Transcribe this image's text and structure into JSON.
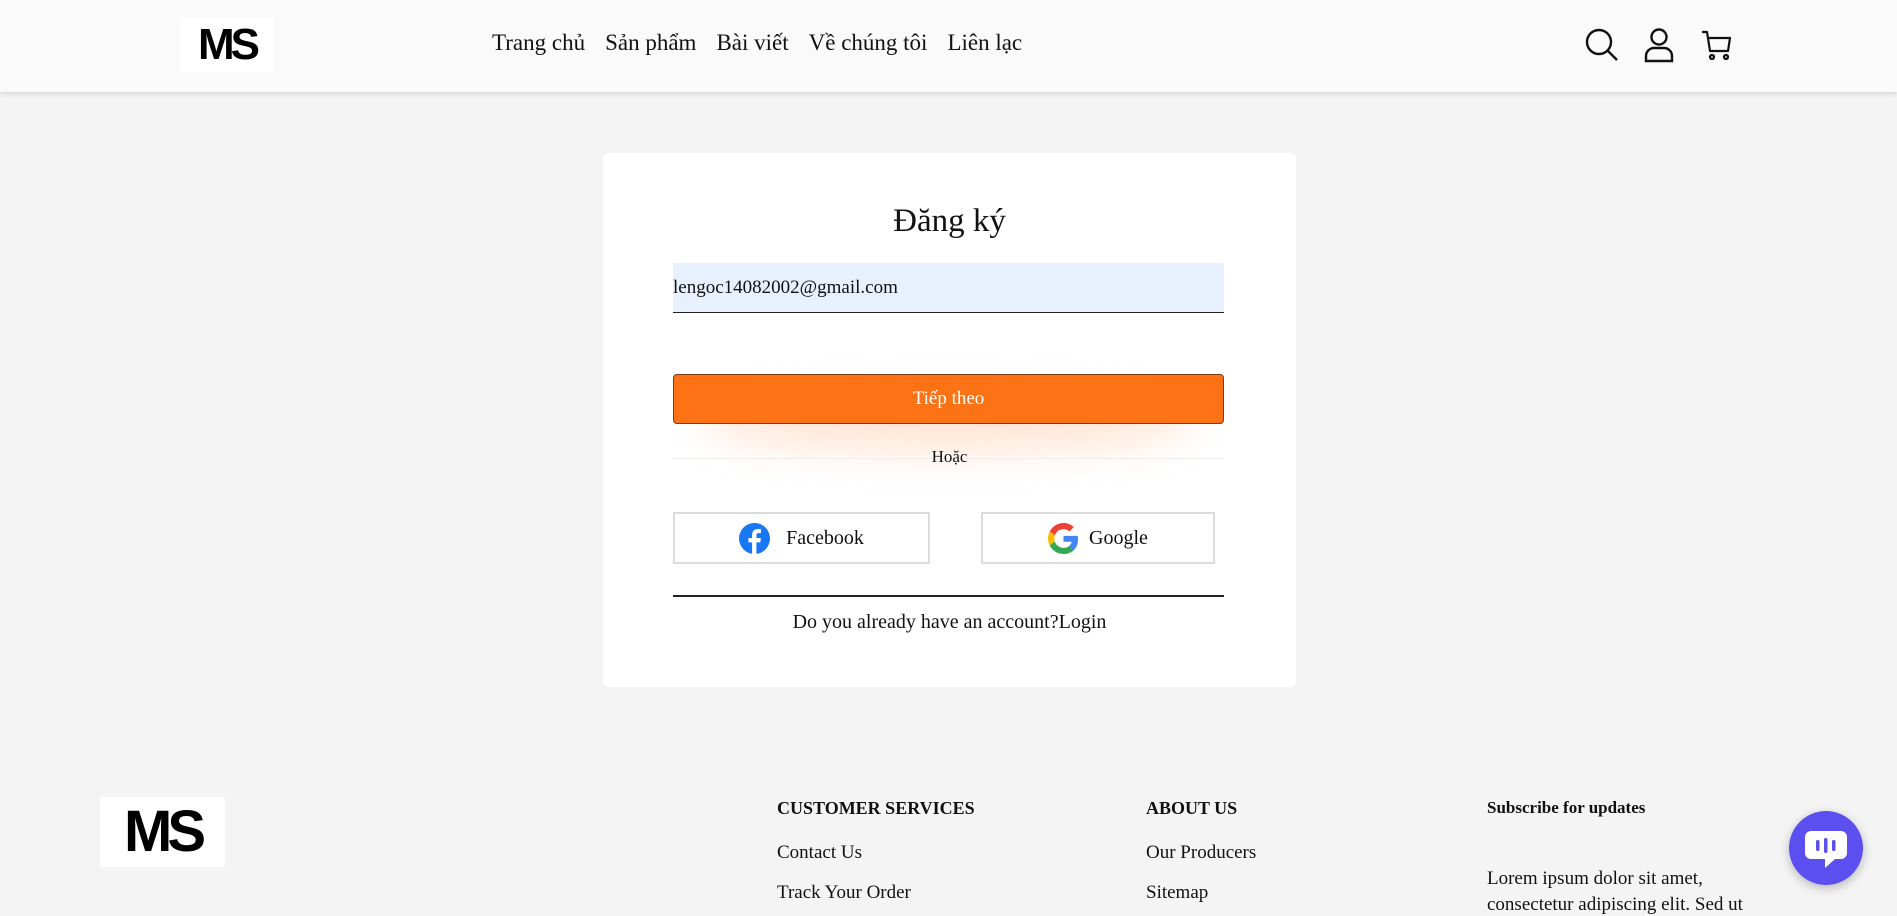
{
  "header": {
    "logo_text": "MS",
    "nav": [
      "Trang chủ",
      "Sản phẩm",
      "Bài viết",
      "Về chúng tôi",
      "Liên lạc"
    ],
    "icons": [
      "search-icon",
      "user-icon",
      "cart-icon"
    ]
  },
  "signup": {
    "title": "Đăng ký",
    "email_value": "lengoc14082002@gmail.com",
    "next_label": "Tiếp theo",
    "or_label": "Hoặc",
    "facebook_label": "Facebook",
    "google_label": "Google",
    "have_account": "Do you already have an account?",
    "login_label": "Login"
  },
  "footer": {
    "logo_text": "MS",
    "customer_services": {
      "heading": "CUSTOMER SERVICES",
      "links": [
        "Contact Us",
        "Track Your Order"
      ]
    },
    "about_us": {
      "heading": "ABOUT US",
      "links": [
        "Our Producers",
        "Sitemap"
      ]
    },
    "subscribe": {
      "heading": "Subscribe for updates",
      "text": "Lorem ipsum dolor sit amet,",
      "text_cut": "consectetur adipiscing elit. Sed ut"
    }
  },
  "colors": {
    "accent": "#fc7214",
    "chat": "#5b4ff0",
    "input_bg": "#e8f0fe"
  }
}
